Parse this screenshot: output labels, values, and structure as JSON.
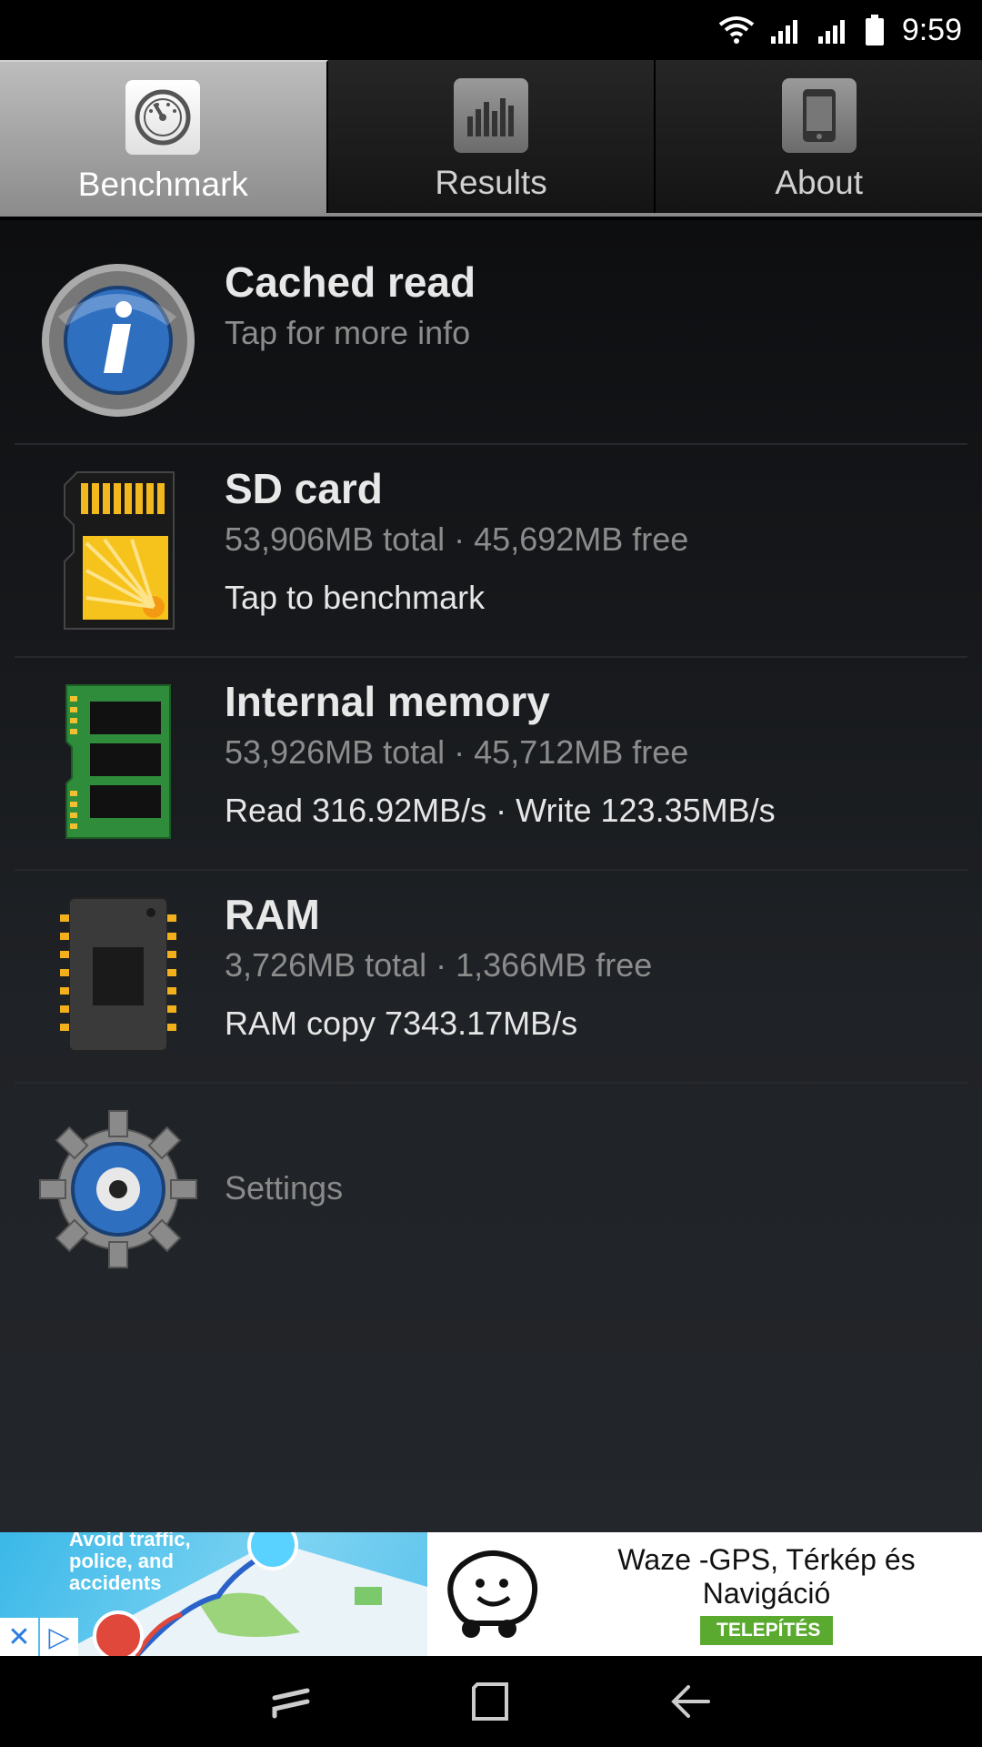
{
  "status_bar": {
    "time": "9:59",
    "icons": [
      "wifi-icon",
      "signal-icon",
      "signal-icon",
      "battery-icon"
    ]
  },
  "tabs": [
    {
      "label": "Benchmark",
      "icon": "gauge-icon",
      "active": true
    },
    {
      "label": "Results",
      "icon": "bar-chart-icon",
      "active": false
    },
    {
      "label": "About",
      "icon": "phone-icon",
      "active": false
    }
  ],
  "rows": {
    "cached_read": {
      "title": "Cached read",
      "subtitle": "Tap for more info",
      "icon": "info-icon"
    },
    "sd_card": {
      "title": "SD card",
      "subtitle": "53,906MB total · 45,692MB free",
      "detail": "Tap to benchmark",
      "icon": "sd-card-icon"
    },
    "internal_memory": {
      "title": "Internal memory",
      "subtitle": "53,926MB total · 45,712MB free",
      "detail": "Read 316.92MB/s · Write 123.35MB/s",
      "icon": "memory-chip-icon"
    },
    "ram": {
      "title": "RAM",
      "subtitle": "3,726MB total · 1,366MB free",
      "detail": "RAM copy 7343.17MB/s",
      "icon": "ram-chip-icon"
    },
    "settings": {
      "title": "Settings",
      "icon": "gear-icon"
    }
  },
  "ad": {
    "tagline": "Avoid traffic, police, and accidents",
    "app_name": "Waze -GPS, Térkép és Navigáció",
    "cta": "TELEPÍTÉS",
    "colors": {
      "cta": "#5aaa30",
      "art": "#3ab8e8"
    }
  },
  "navbar": {
    "buttons": [
      "recent-apps-icon",
      "home-icon",
      "back-icon"
    ]
  },
  "colors": {
    "background": "#1f2226",
    "title_text": "#e8e8e8",
    "subtitle_text": "#8c8c8c",
    "active_tab": "#bdbdbd"
  }
}
